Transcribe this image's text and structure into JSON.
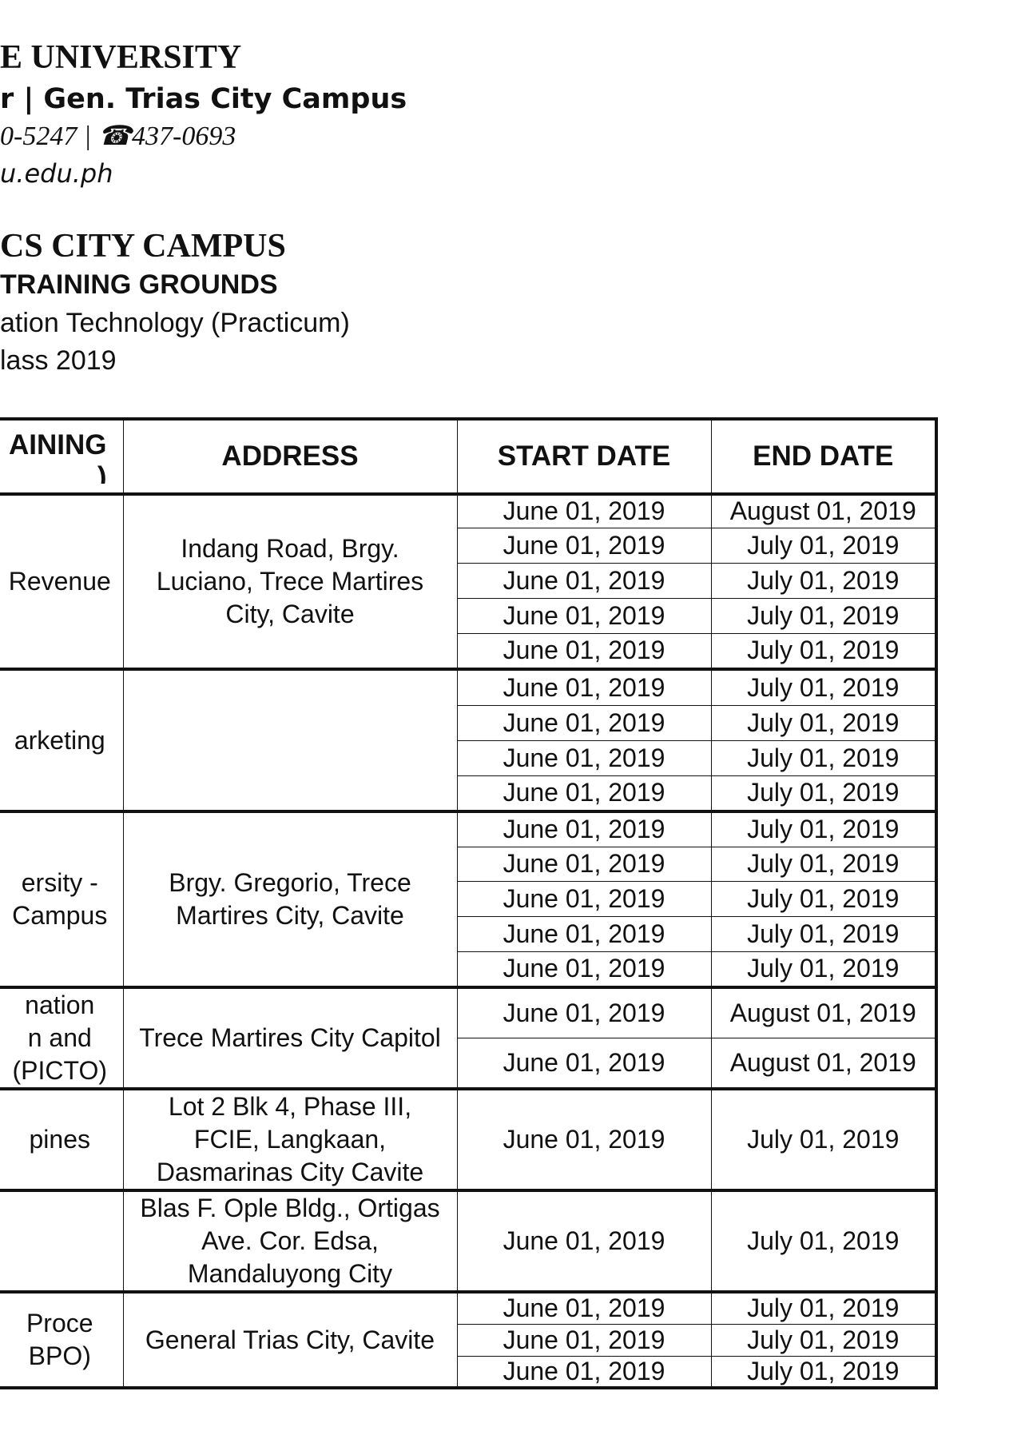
{
  "header": {
    "university": "E UNIVERSITY",
    "campus_line": "r | Gen. Trias City Campus",
    "contact": "0-5247 | ☎437-0693",
    "website": "u.edu.ph",
    "campus_title": "CS CITY CAMPUS",
    "training_title": "TRAINING GROUNDS",
    "course": "ation Technology (Practicum)",
    "class": "lass 2019"
  },
  "table": {
    "headers": {
      "name_line1": "AINING",
      "name_line2": ")",
      "address": "ADDRESS",
      "start_date": "START DATE",
      "end_date": "END DATE"
    },
    "groups": [
      {
        "name_lines": [
          "Revenue"
        ],
        "address_lines": [
          "Indang Road, Brgy.",
          "Luciano, Trece Martires",
          "City, Cavite"
        ],
        "rows": [
          {
            "start": "June 01, 2019",
            "end": "August 01, 2019"
          },
          {
            "start": "June 01, 2019",
            "end": "July 01, 2019"
          },
          {
            "start": "June 01, 2019",
            "end": "July 01, 2019"
          },
          {
            "start": "June 01, 2019",
            "end": "July 01, 2019"
          },
          {
            "start": "June 01, 2019",
            "end": "July 01, 2019"
          }
        ]
      },
      {
        "name_lines": [
          "arketing"
        ],
        "address_lines": [],
        "rows": [
          {
            "start": "June 01, 2019",
            "end": "July 01, 2019"
          },
          {
            "start": "June 01, 2019",
            "end": "July 01, 2019"
          },
          {
            "start": "June 01, 2019",
            "end": "July 01, 2019"
          },
          {
            "start": "June 01, 2019",
            "end": "July 01, 2019"
          }
        ]
      },
      {
        "name_lines": [
          "ersity -",
          "Campus"
        ],
        "address_lines": [
          "Brgy. Gregorio, Trece",
          "Martires City, Cavite"
        ],
        "rows": [
          {
            "start": "June 01, 2019",
            "end": "July 01, 2019"
          },
          {
            "start": "June 01, 2019",
            "end": "July 01, 2019"
          },
          {
            "start": "June 01, 2019",
            "end": "July 01, 2019"
          },
          {
            "start": "June 01, 2019",
            "end": "July 01, 2019"
          },
          {
            "start": "June 01, 2019",
            "end": "July 01, 2019"
          }
        ]
      },
      {
        "name_lines": [
          "nation",
          "n and",
          "(PICTO)"
        ],
        "address_lines": [
          "Trece Martires City Capitol"
        ],
        "rows": [
          {
            "start": "June 01, 2019",
            "end": "August 01, 2019"
          },
          {
            "start": "June 01, 2019",
            "end": "August 01, 2019"
          }
        ]
      },
      {
        "name_lines": [
          "pines"
        ],
        "address_lines": [
          "Lot 2 Blk 4, Phase III,",
          "FCIE, Langkaan,",
          "Dasmarinas City Cavite"
        ],
        "rows": [
          {
            "start": "June 01, 2019",
            "end": "July 01, 2019"
          }
        ]
      },
      {
        "name_lines": [],
        "address_lines": [
          "Blas F. Ople Bldg., Ortigas",
          "Ave. Cor. Edsa,",
          "Mandaluyong City"
        ],
        "rows": [
          {
            "start": "June 01, 2019",
            "end": "July 01, 2019"
          }
        ]
      },
      {
        "name_lines": [
          "Proce",
          "BPO)"
        ],
        "address_lines": [
          "General Trias City, Cavite"
        ],
        "rows": [
          {
            "start": "June 01, 2019",
            "end": "July 01, 2019"
          },
          {
            "start": "June 01, 2019",
            "end": "July 01, 2019"
          },
          {
            "start": "June 01, 2019",
            "end": "July 01, 2019"
          }
        ]
      }
    ]
  }
}
